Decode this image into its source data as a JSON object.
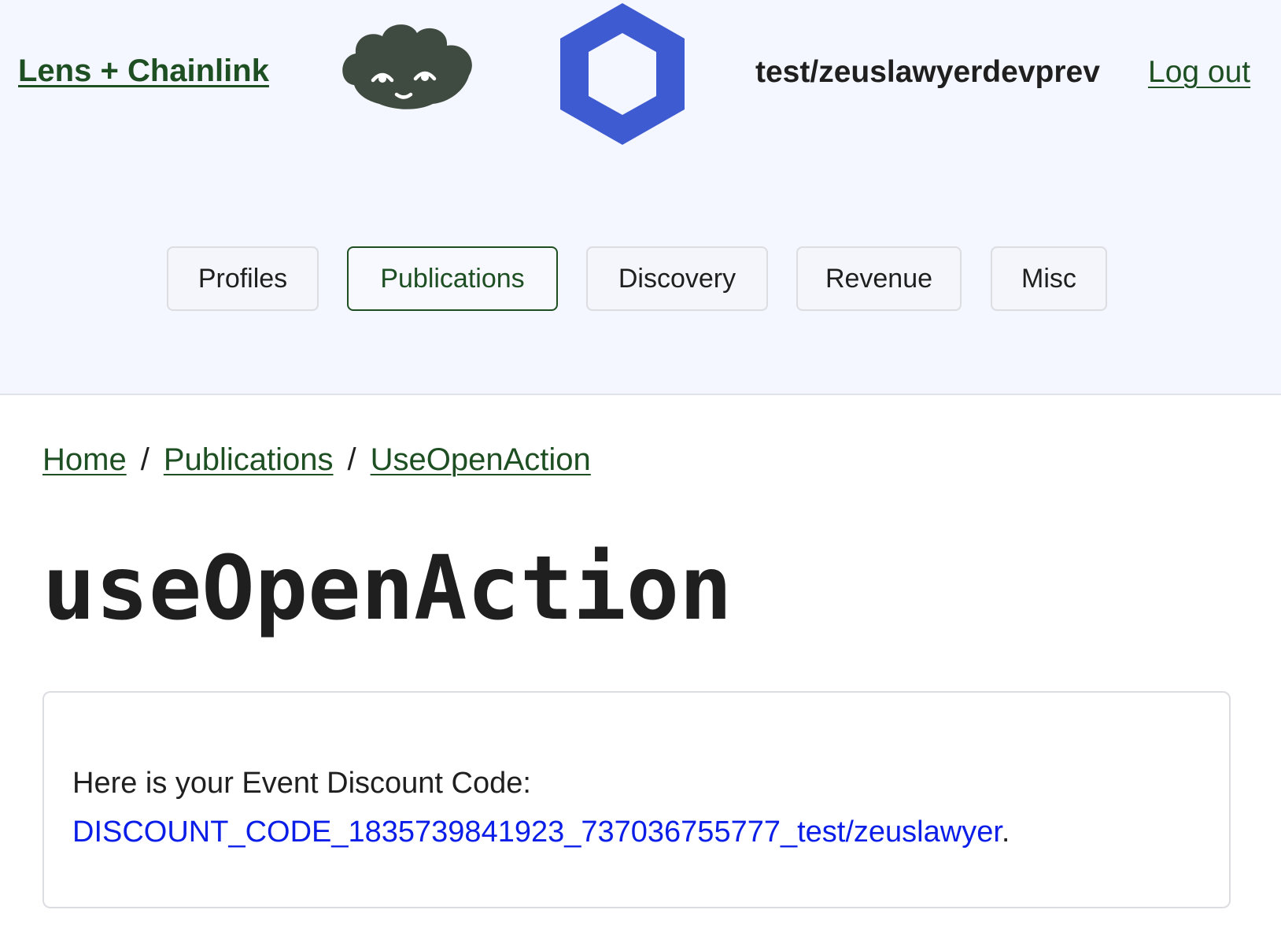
{
  "header": {
    "brand_label": "Lens + Chainlink",
    "lens_logo_icon": "lens-cloud-face-icon",
    "chainlink_logo_icon": "chainlink-hexagon-icon",
    "username": "test/zeuslawyerdevprev",
    "logout_label": "Log out",
    "colors": {
      "background": "#f4f7ff",
      "link_green": "#1d4f22",
      "lens_logo": "#3f4a40",
      "chainlink_blue": "#3f5bd1"
    }
  },
  "nav": {
    "tabs": [
      {
        "label": "Profiles",
        "active": false
      },
      {
        "label": "Publications",
        "active": true
      },
      {
        "label": "Discovery",
        "active": false
      },
      {
        "label": "Revenue",
        "active": false
      },
      {
        "label": "Misc",
        "active": false
      }
    ]
  },
  "breadcrumb": {
    "items": [
      "Home",
      "Publications",
      "UseOpenAction"
    ],
    "separator": "/"
  },
  "page": {
    "title": "useOpenAction"
  },
  "result": {
    "intro": "Here is your Event Discount Code:",
    "code": "DISCOUNT_CODE_1835739841923_737036755777_test/zeuslawyer",
    "suffix": ".",
    "code_color": "#0a1ee8"
  }
}
